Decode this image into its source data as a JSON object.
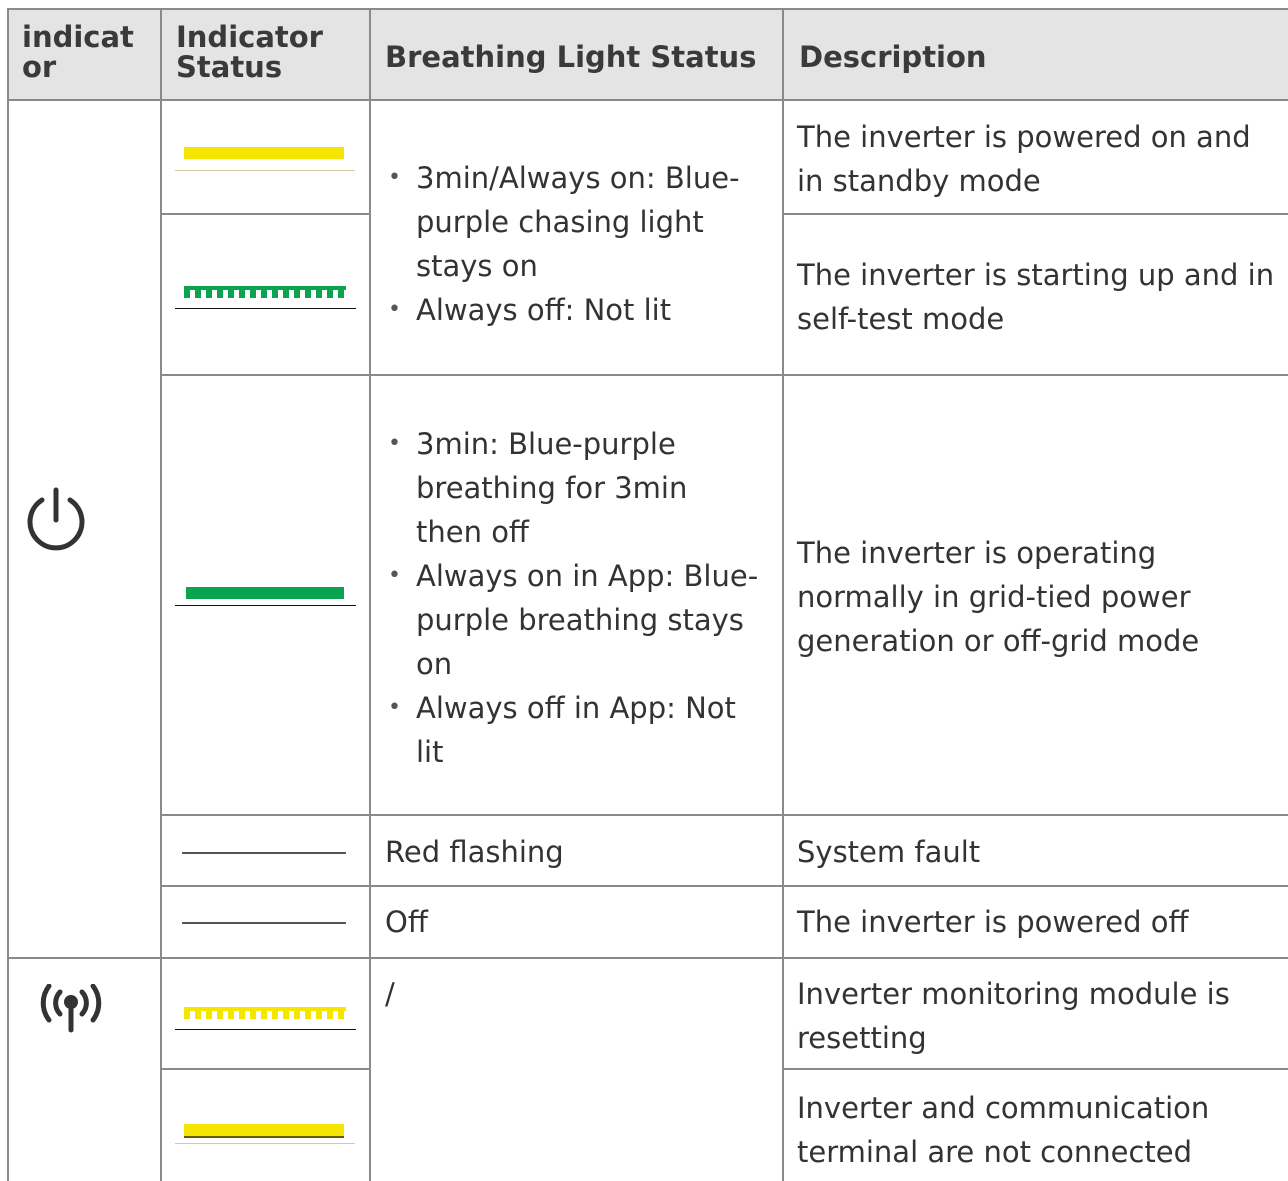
{
  "table": {
    "headers": [
      "indicat or",
      "Indicator Status",
      "Breathing Light Status",
      "Description"
    ],
    "header_lines": {
      "col1": [
        "indicat",
        "or"
      ],
      "col2": [
        "Indicator",
        "Status"
      ]
    },
    "rows": {
      "standby_desc": "The inverter is powered on and in standby mode",
      "selftest_desc": "The inverter is starting up and in self-test mode",
      "group1_bullets": [
        "3min/Always on: Blue-purple chasing light stays on",
        "Always off: Not lit"
      ],
      "group1_lines": [
        "3min/Always on: Blue-",
        "purple chasing light",
        "stays on"
      ],
      "normal_bullets_lines": [
        [
          "3min: Blue-purple",
          "breathing for 3min",
          "then off"
        ],
        [
          "Always on in App: Blue-",
          "purple breathing stays",
          "on"
        ],
        [
          "Always off in App: Not",
          "lit"
        ]
      ],
      "normal_desc": "The inverter is operating normally in grid-tied power generation or off-grid mode",
      "fault_status": "Red flashing",
      "fault_desc": "System fault",
      "off_status": "Off",
      "off_desc": "The inverter is powered off",
      "reset_status": "/",
      "reset_desc": "Inverter monitoring module is resetting",
      "disconnected_desc": "Inverter and communication terminal are not connected"
    }
  },
  "icons": {
    "power": "power-icon",
    "wifi": "wireless-signal-icon"
  },
  "colors": {
    "yellow": "#f5e600",
    "green": "#0aa34f",
    "header_bg": "#e4e4e4",
    "border": "#8a8a8a",
    "dark_line": "#222222"
  }
}
